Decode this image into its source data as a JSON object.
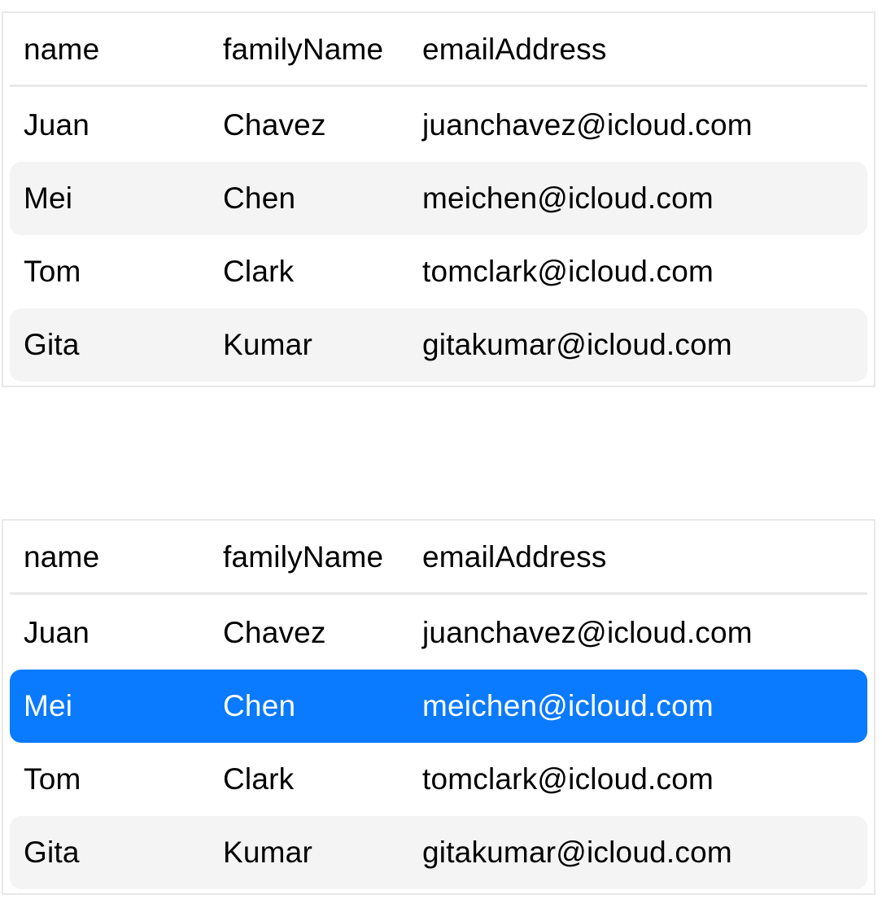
{
  "tables": [
    {
      "columns": [
        "name",
        "familyName",
        "emailAddress"
      ],
      "rows": [
        {
          "name": "Juan",
          "familyName": "Chavez",
          "emailAddress": "juanchavez@icloud.com"
        },
        {
          "name": "Mei",
          "familyName": "Chen",
          "emailAddress": "meichen@icloud.com"
        },
        {
          "name": "Tom",
          "familyName": "Clark",
          "emailAddress": "tomclark@icloud.com"
        },
        {
          "name": "Gita",
          "familyName": "Kumar",
          "emailAddress": "gitakumar@icloud.com"
        }
      ],
      "selected_row": null
    },
    {
      "columns": [
        "name",
        "familyName",
        "emailAddress"
      ],
      "rows": [
        {
          "name": "Juan",
          "familyName": "Chavez",
          "emailAddress": "juanchavez@icloud.com"
        },
        {
          "name": "Mei",
          "familyName": "Chen",
          "emailAddress": "meichen@icloud.com"
        },
        {
          "name": "Tom",
          "familyName": "Clark",
          "emailAddress": "tomclark@icloud.com"
        },
        {
          "name": "Gita",
          "familyName": "Kumar",
          "emailAddress": "gitakumar@icloud.com"
        }
      ],
      "selected_row": 1
    }
  ],
  "colors": {
    "stripe": "#f4f4f4",
    "selection": "#0a7aff",
    "border": "#e8e8e8"
  }
}
